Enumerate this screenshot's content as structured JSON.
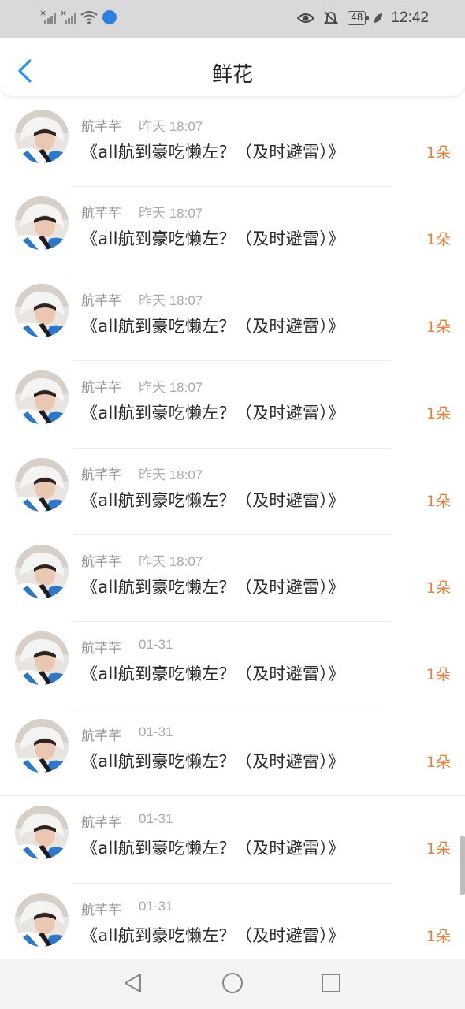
{
  "status_bar": {
    "time": "12:42",
    "battery": "48",
    "icons": [
      "signal-1-icon",
      "signal-2-icon",
      "wifi-icon",
      "app-badge-icon",
      "eye-icon",
      "bell-off-icon",
      "battery-icon",
      "leaf-icon"
    ]
  },
  "header": {
    "title": "鲜花",
    "back_icon": "chevron-left-icon"
  },
  "list": {
    "items": [
      {
        "name": "航芊芊",
        "time": "昨天 18:07",
        "book": "《all航到豪吃懒左？（及时避雷）》",
        "count": "1朵"
      },
      {
        "name": "航芊芊",
        "time": "昨天 18:07",
        "book": "《all航到豪吃懒左？（及时避雷）》",
        "count": "1朵"
      },
      {
        "name": "航芊芊",
        "time": "昨天 18:07",
        "book": "《all航到豪吃懒左？（及时避雷）》",
        "count": "1朵"
      },
      {
        "name": "航芊芊",
        "time": "昨天 18:07",
        "book": "《all航到豪吃懒左？（及时避雷）》",
        "count": "1朵"
      },
      {
        "name": "航芊芊",
        "time": "昨天 18:07",
        "book": "《all航到豪吃懒左？（及时避雷）》",
        "count": "1朵"
      },
      {
        "name": "航芊芊",
        "time": "昨天 18:07",
        "book": "《all航到豪吃懒左？（及时避雷）》",
        "count": "1朵"
      },
      {
        "name": "航芊芊",
        "time": "01-31",
        "book": "《all航到豪吃懒左？（及时避雷）》",
        "count": "1朵"
      },
      {
        "name": "航芊芊",
        "time": "01-31",
        "book": "《all航到豪吃懒左？（及时避雷）》",
        "count": "1朵"
      },
      {
        "name": "航芊芊",
        "time": "01-31",
        "book": "《all航到豪吃懒左？（及时避雷）》",
        "count": "1朵"
      },
      {
        "name": "航芊芊",
        "time": "01-31",
        "book": "《all航到豪吃懒左？（及时避雷）》",
        "count": "1朵"
      }
    ]
  },
  "navbar": {
    "icons": [
      "nav-back-icon",
      "nav-home-icon",
      "nav-recent-icon"
    ]
  },
  "colors": {
    "accent_count": "#e8823a",
    "back_arrow": "#2196f3",
    "status_bar_bg": "#d9d9d9"
  }
}
